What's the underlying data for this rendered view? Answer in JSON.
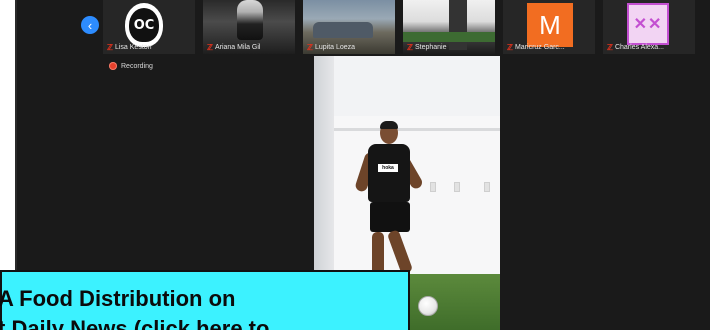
{
  "participants": [
    {
      "name": "Lisa Keston",
      "type": "logo",
      "logo_text": "OC"
    },
    {
      "name": "Ariana Mila Gil",
      "type": "photo"
    },
    {
      "name": "Lupita Loeza",
      "type": "photo"
    },
    {
      "name": "Stephanie",
      "type": "photo"
    },
    {
      "name": "Maricruz Garc...",
      "type": "initial",
      "initial": "M",
      "color": "#f26d21"
    },
    {
      "name": "Charles Alexa...",
      "type": "icon",
      "glyph": "✕✕",
      "color": "#c34fd1"
    }
  ],
  "icons": {
    "back": "chevron-left-icon",
    "mic_muted": "mic-muted-icon",
    "recording": "recording-dot-icon"
  },
  "controls": {
    "back_glyph": "‹"
  },
  "recording": {
    "label": "Recording"
  },
  "main_video": {
    "jersey_text": "hoka"
  },
  "caption": {
    "line1": "A Food Distribution on",
    "line2": "t Daily News (click here to"
  },
  "colors": {
    "accent": "#2d8cff",
    "recording": "#e8412c",
    "caption_bg": "#3cf2ff",
    "meeting_bg": "#1a1a1a"
  }
}
